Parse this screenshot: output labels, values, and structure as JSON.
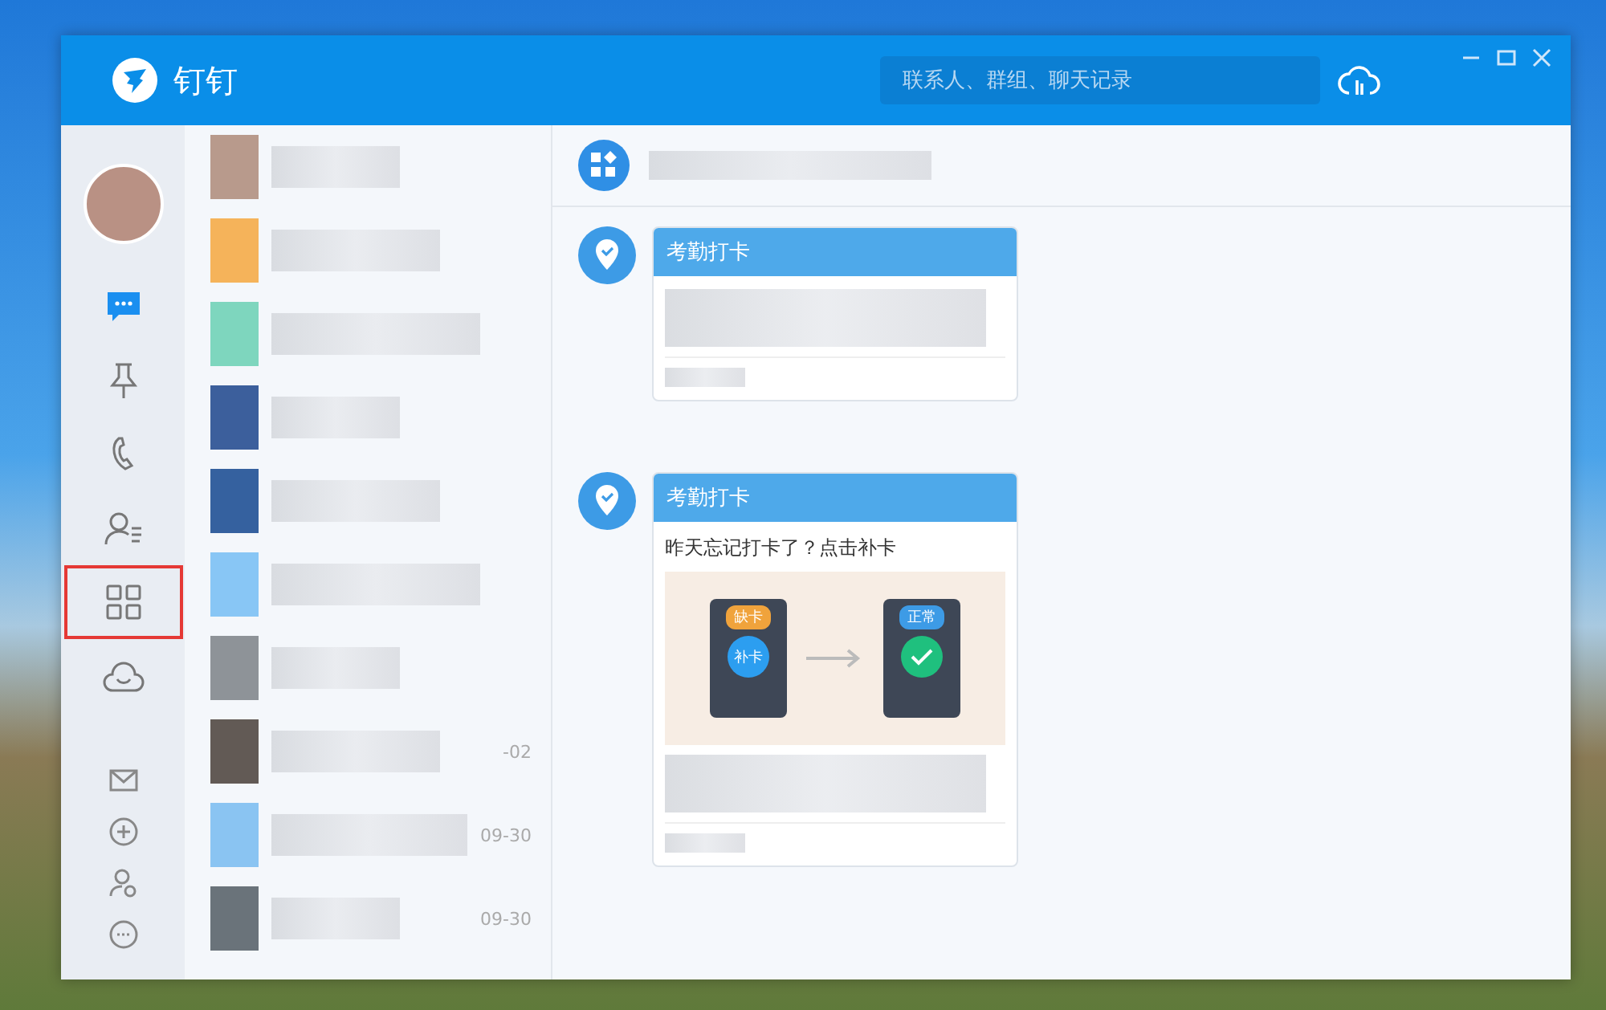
{
  "window": {
    "title": "钉钉"
  },
  "search": {
    "placeholder": "联系人、群组、聊天记录"
  },
  "nav": [
    {
      "kind": "chat",
      "selected": true,
      "highlighted": false
    },
    {
      "kind": "pin",
      "selected": false,
      "highlighted": false
    },
    {
      "kind": "phone",
      "selected": false,
      "highlighted": false
    },
    {
      "kind": "contacts",
      "selected": false,
      "highlighted": false
    },
    {
      "kind": "apps",
      "selected": false,
      "highlighted": true
    },
    {
      "kind": "cloud",
      "selected": false,
      "highlighted": false
    }
  ],
  "nav_bottom": [
    {
      "kind": "mail"
    },
    {
      "kind": "plus"
    },
    {
      "kind": "user"
    },
    {
      "kind": "more"
    }
  ],
  "chats": [
    {
      "color": "#b89a8c"
    },
    {
      "color": "#f5b35a"
    },
    {
      "color": "#7ed6be"
    },
    {
      "color": "#3c5f9c"
    },
    {
      "color": "#35619f"
    },
    {
      "color": "#88c6f5"
    },
    {
      "color": "#8e9398"
    },
    {
      "color": "#625a55",
      "time": "-02"
    },
    {
      "color": "#8ac4f2",
      "time": "09-30"
    },
    {
      "color": "#6a737a",
      "time": "09-30"
    }
  ],
  "messages": [
    {
      "kind": "plain",
      "title": "考勤打卡"
    },
    {
      "kind": "illustrated",
      "title": "考勤打卡",
      "text": "昨天忘记打卡了？点击补卡",
      "badge_left": "缺卡",
      "button_left": "补卡",
      "badge_right": "正常"
    }
  ]
}
